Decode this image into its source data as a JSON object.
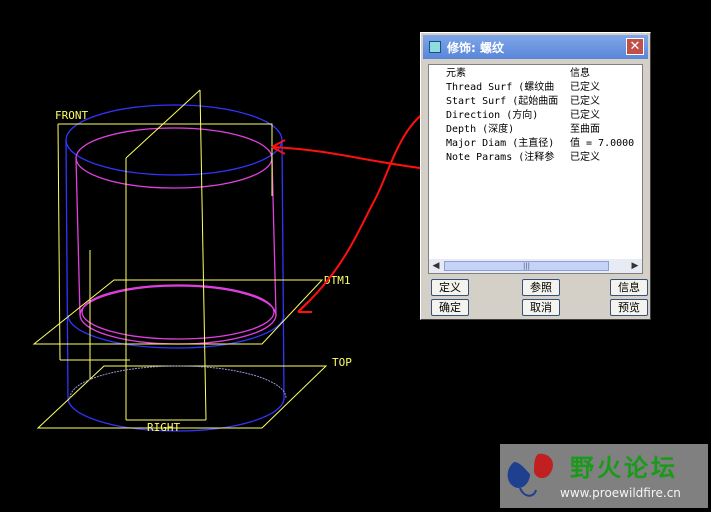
{
  "viewport": {
    "labels": {
      "front": "FRONT",
      "dtm1": "DTM1",
      "top": "TOP",
      "right": "RIGHT"
    }
  },
  "dialog": {
    "title": "修饰: 螺纹",
    "close_glyph": "✕",
    "columns": {
      "element": "元素",
      "info": "信息"
    },
    "rows": [
      {
        "element": "Thread Surf (螺纹曲",
        "info": "已定义"
      },
      {
        "element": "Start Surf (起始曲面",
        "info": "已定义"
      },
      {
        "element": "Direction (方向)",
        "info": "已定义"
      },
      {
        "element": "Depth (深度)",
        "info": "至曲面"
      },
      {
        "element": "Major Diam (主直径)",
        "info": "值 = 7.0000"
      },
      {
        "element": "Note Params (注释参",
        "info": "已定义"
      }
    ],
    "scrollbar": {
      "left": "◀",
      "right": "▶",
      "thumb": "|||"
    },
    "buttons": {
      "define": "定义",
      "refs": "参照",
      "info": "信息",
      "ok": "确定",
      "cancel": "取消",
      "preview": "预览"
    }
  },
  "watermark": {
    "title": "野火论坛",
    "url": "www.proewildfire.cn"
  },
  "colors": {
    "datum": "#ffff66",
    "edge_blue": "#3333ff",
    "edge_magenta": "#e040e0",
    "annotation": "#ff1010"
  }
}
